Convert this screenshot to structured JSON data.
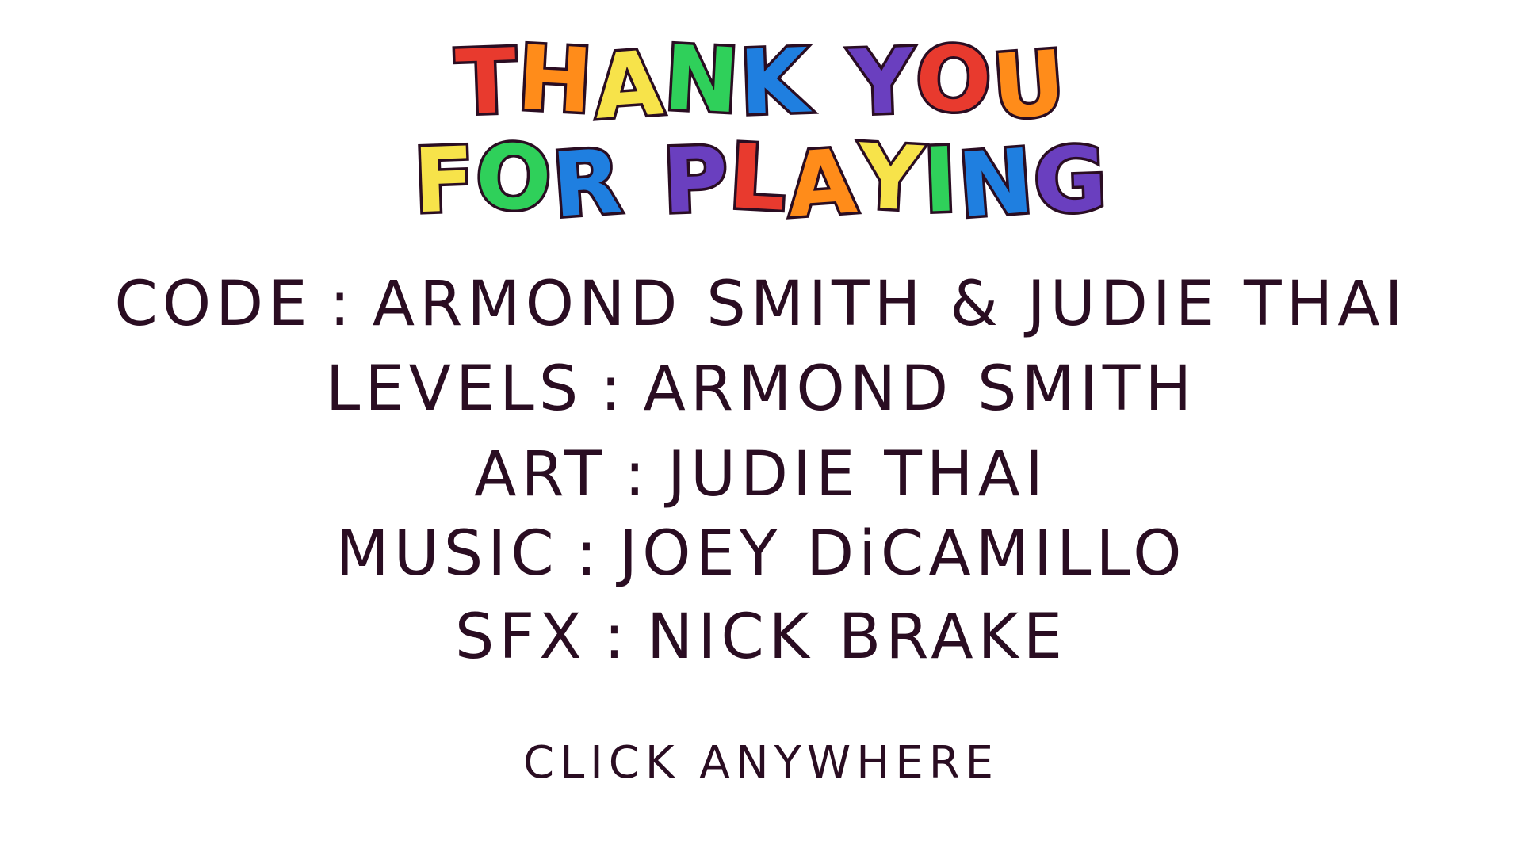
{
  "title": {
    "line1": [
      {
        "text": "THANK",
        "colors": [
          "#e83a2e",
          "#ff8c1a",
          "#f7e34a",
          "#2fd05a",
          "#1f7fe0"
        ]
      },
      {
        "text": "YOU",
        "colors": [
          "#6a3fbf",
          "#e83a2e",
          "#ff8c1a"
        ]
      }
    ],
    "line2": [
      {
        "text": "FOR",
        "colors": [
          "#f7e34a",
          "#2fd05a",
          "#1f7fe0"
        ]
      },
      {
        "text": "PLAYING",
        "colors": [
          "#6a3fbf",
          "#e83a2e",
          "#ff8c1a",
          "#f7e34a",
          "#2fd05a",
          "#1f7fe0",
          "#6a3fbf"
        ]
      }
    ],
    "outline_color": "#2a0d22"
  },
  "credits": {
    "code": {
      "label": "CODE",
      "sep": ":",
      "value": "ARMOND SMITH & JUDIE THAI"
    },
    "levels": {
      "label": "LEVELS",
      "sep": ":",
      "value": "ARMOND SMITH"
    },
    "art": {
      "label": "ART",
      "sep": ":",
      "value": "JUDIE THAI"
    },
    "music": {
      "label": "MUSIC",
      "sep": ":",
      "value": "JOEY DiCAMILLO"
    },
    "sfx": {
      "label": "SFX",
      "sep": ":",
      "value": "NICK BRAKE"
    }
  },
  "prompt": "CLICK ANYWHERE",
  "colors": {
    "background": "#ffffff",
    "text": "#2a0d22"
  }
}
